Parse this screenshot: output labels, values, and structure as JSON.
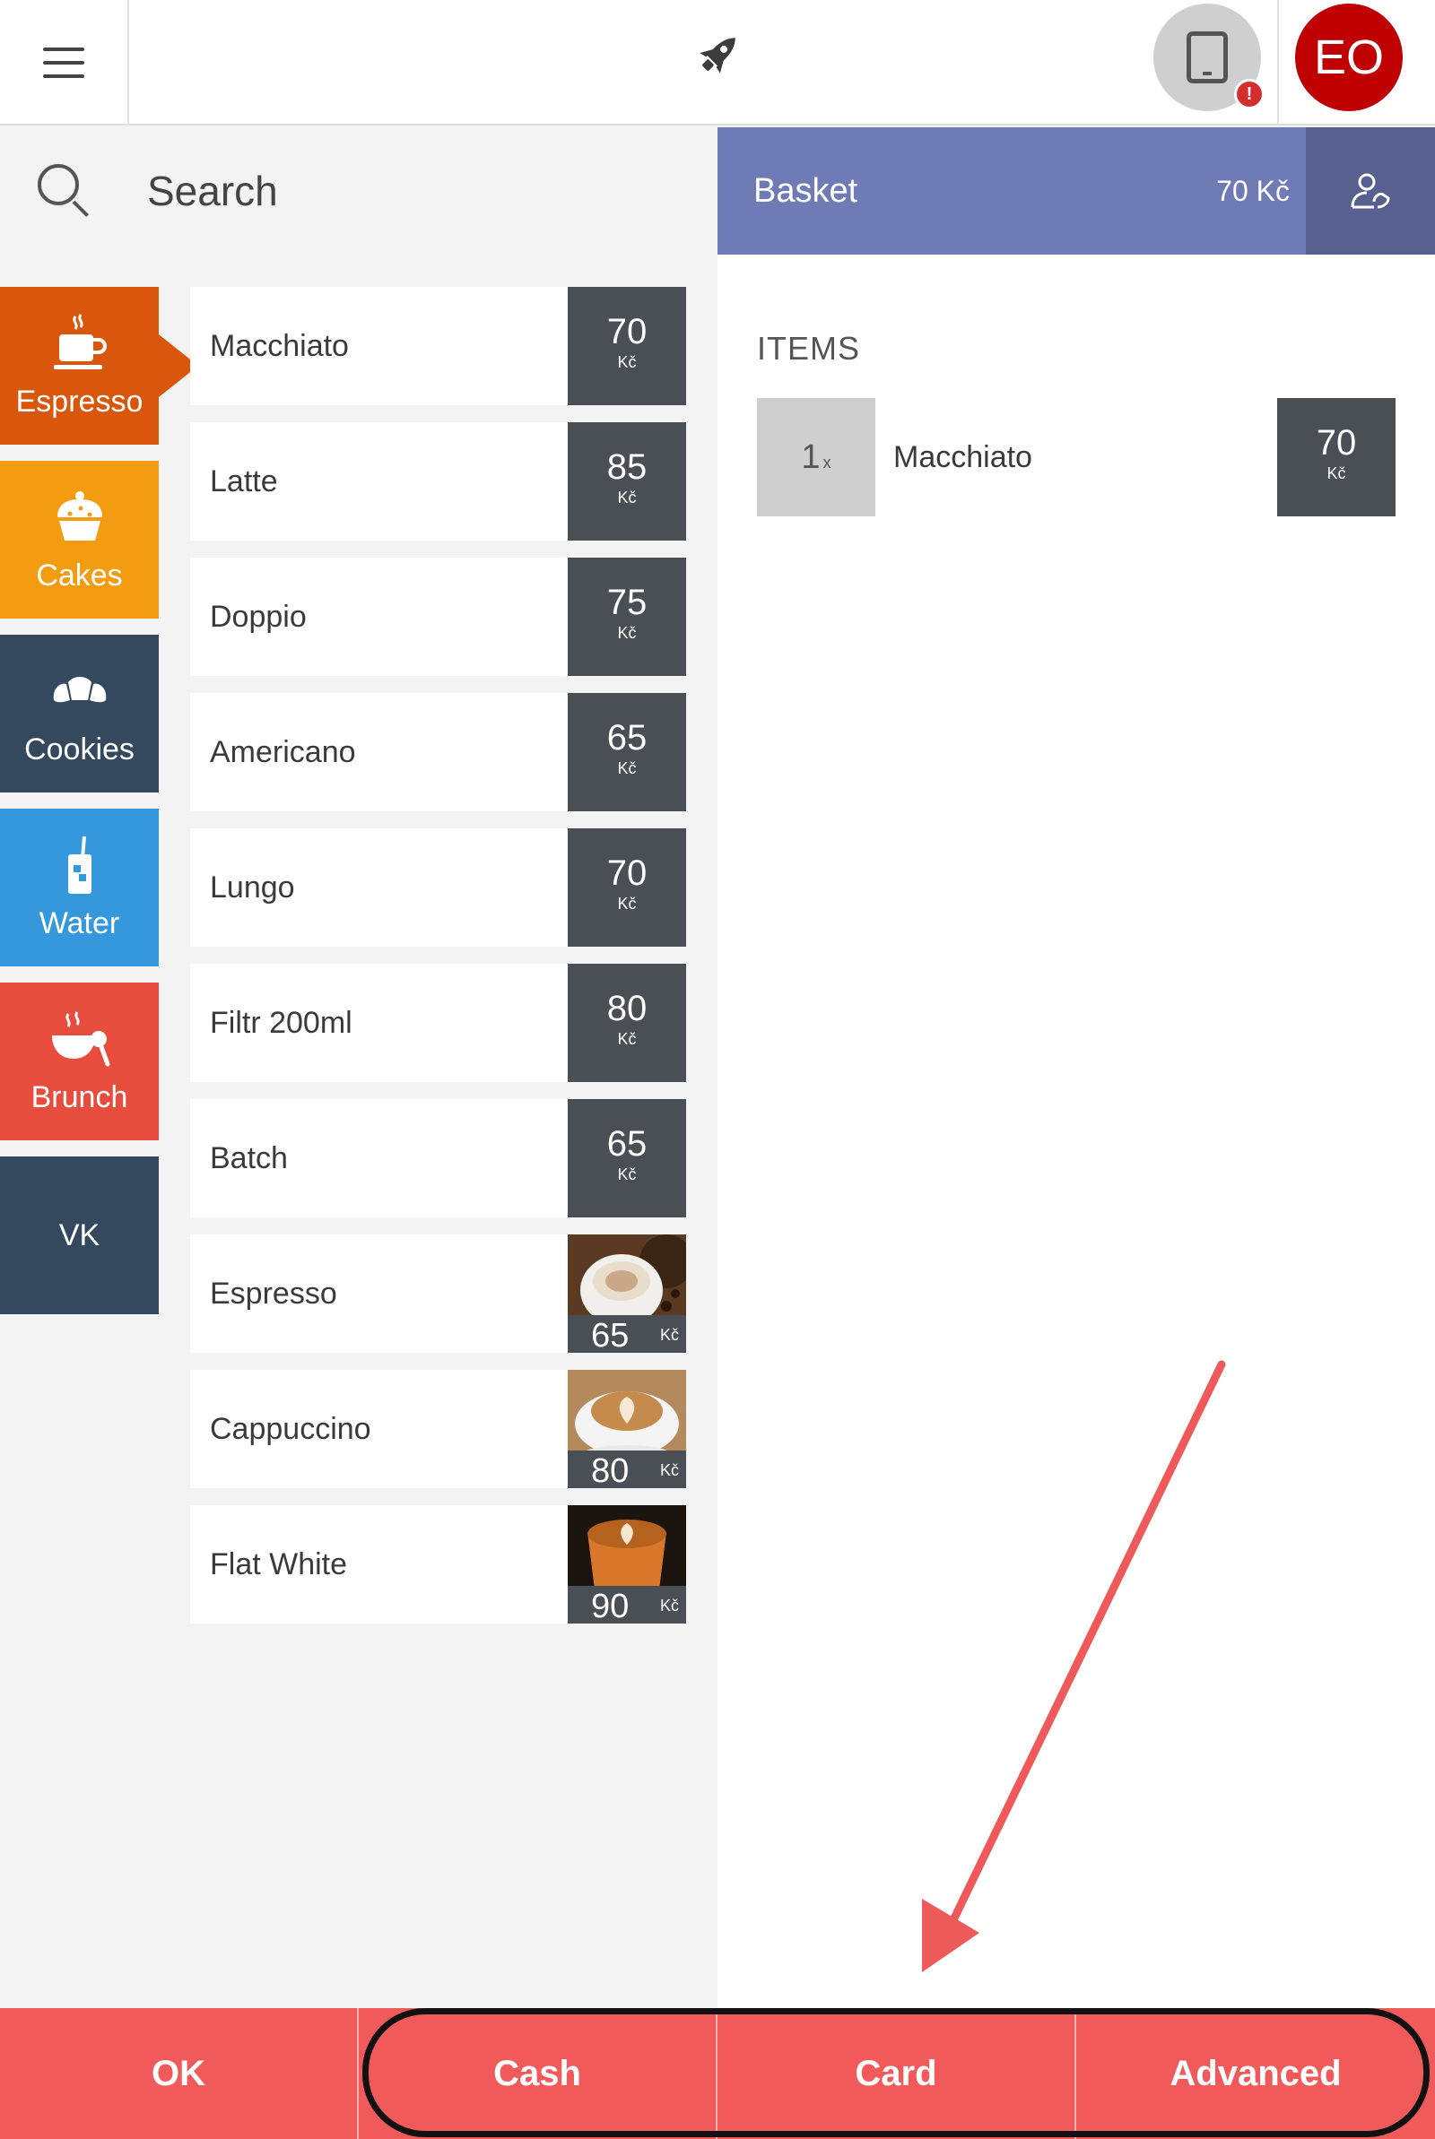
{
  "topbar": {
    "menu_icon": "hamburger-menu-icon",
    "center_icon": "rocket-icon",
    "device_icon": "tablet-icon",
    "device_badge": "!",
    "user_initials": "EO"
  },
  "search": {
    "placeholder": "Search",
    "icon": "search-icon"
  },
  "categories": [
    {
      "label": "Espresso",
      "icon": "coffee-cup-icon",
      "color": "#d9570d",
      "active": true
    },
    {
      "label": "Cakes",
      "icon": "cupcake-icon",
      "color": "#f39c12"
    },
    {
      "label": "Cookies",
      "icon": "croissant-icon",
      "color": "#34495e"
    },
    {
      "label": "Water",
      "icon": "drink-glass-icon",
      "color": "#3598dc"
    },
    {
      "label": "Brunch",
      "icon": "brunch-bowl-icon",
      "color": "#e74c3c"
    },
    {
      "label": "VK",
      "icon": "",
      "color": "#34495e"
    }
  ],
  "currency": "Kč",
  "products": [
    {
      "name": "Macchiato",
      "price": "70"
    },
    {
      "name": "Latte",
      "price": "85"
    },
    {
      "name": "Doppio",
      "price": "75"
    },
    {
      "name": "Americano",
      "price": "65"
    },
    {
      "name": "Lungo",
      "price": "70"
    },
    {
      "name": "Filtr 200ml",
      "price": "80"
    },
    {
      "name": "Batch",
      "price": "65"
    },
    {
      "name": "Espresso",
      "price": "65",
      "photo": "espresso-photo"
    },
    {
      "name": "Cappuccino",
      "price": "80",
      "photo": "cappuccino-photo"
    },
    {
      "name": "Flat White",
      "price": "90",
      "photo": "flat-white-photo"
    }
  ],
  "basket": {
    "title": "Basket",
    "total": "70 Kč",
    "customer_icon": "customer-add-icon",
    "items_label": "ITEMS",
    "items": [
      {
        "qty": "1",
        "qty_suffix": "x",
        "name": "Macchiato",
        "price": "70"
      }
    ]
  },
  "actions": {
    "ok": "OK",
    "cash": "Cash",
    "card": "Card",
    "advanced": "Advanced"
  },
  "colors": {
    "basket_header": "#6f7bb5",
    "customer_button": "#58608f",
    "action_bar": "#f05a5a",
    "price_tile": "#4a4f55",
    "annotation_arrow": "#ee5a5a"
  }
}
